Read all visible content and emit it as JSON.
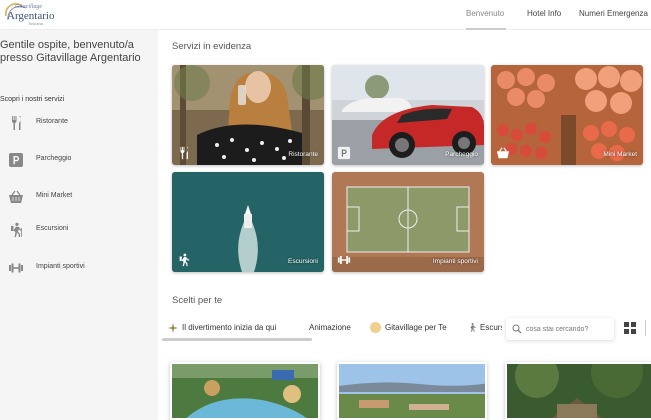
{
  "header": {
    "logo": {
      "line1": "Gitavillage",
      "line2": "Argentario",
      "line3": "Toscana"
    },
    "nav": [
      {
        "label": "Benvenuto",
        "active": true
      },
      {
        "label": "Hotel Info",
        "active": false
      },
      {
        "label": "Numeri Emergenza",
        "active": false
      }
    ]
  },
  "sidebar": {
    "welcome": "Gentile ospite, benvenuto/a presso Gitavillage Argentario",
    "discover": "Scopri i nostri servizi",
    "services": [
      {
        "label": "Ristorante",
        "icon": "cutlery-icon"
      },
      {
        "label": "Parcheggio",
        "icon": "parking-icon"
      },
      {
        "label": "Mini Market",
        "icon": "basket-icon"
      },
      {
        "label": "Escursioni",
        "icon": "hiker-icon"
      },
      {
        "label": "Impianti sportivi",
        "icon": "dumbbell-icon"
      }
    ]
  },
  "featured": {
    "title": "Servizi in evidenza",
    "cards": [
      {
        "label": "Ristorante",
        "icon": "cutlery-icon"
      },
      {
        "label": "Parcheggio",
        "icon": "parking-icon"
      },
      {
        "label": "Mini Market",
        "icon": "basket-icon"
      },
      {
        "label": "Escursioni",
        "icon": "hiker-icon"
      },
      {
        "label": "Impianti sportivi",
        "icon": "dumbbell-icon"
      }
    ]
  },
  "picks": {
    "title": "Scelti per te",
    "chips": [
      {
        "label": "Il divertimento inizia da qui",
        "icon": "sparkle-icon"
      },
      {
        "label": "Animazione",
        "icon": ""
      },
      {
        "label": "Gitavillage per Te",
        "icon": "circle-icon"
      },
      {
        "label": "Escursioni",
        "icon": "hiker-icon"
      }
    ],
    "search_placeholder": "cosa stai cercando?"
  },
  "colors": {
    "sidebar_bg": "#f5f5f5",
    "text": "#444444",
    "accent": "#c9a24a"
  }
}
